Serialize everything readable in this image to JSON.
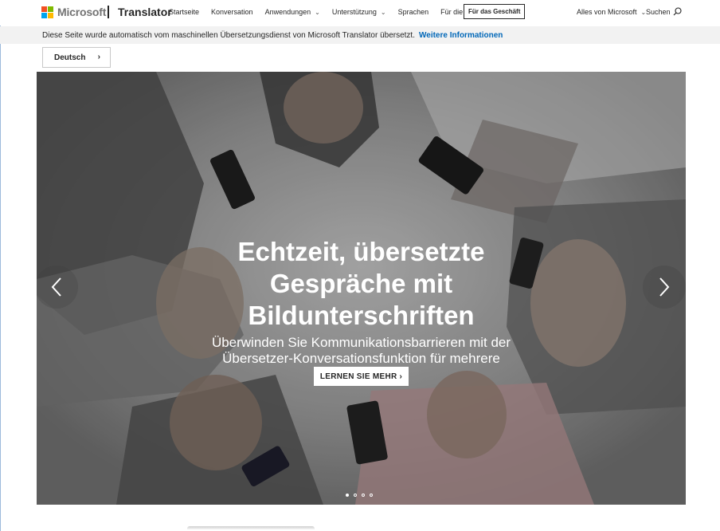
{
  "header": {
    "brand": "Microsoft",
    "product": "Translator",
    "nav": [
      {
        "label": "Startseite",
        "dropdown": false
      },
      {
        "label": "Konversation",
        "dropdown": false
      },
      {
        "label": "Anwendungen",
        "dropdown": true
      },
      {
        "label": "Unterstützung",
        "dropdown": true
      },
      {
        "label": "Sprachen",
        "dropdown": false
      },
      {
        "label": "Für die Bildung",
        "dropdown": false
      }
    ],
    "business_button": "Für das Geschäft",
    "all_microsoft": "Alles von Microsoft",
    "search_label": "Suchen",
    "logo_colors": [
      "#f25022",
      "#7fba00",
      "#00a4ef",
      "#ffb900"
    ]
  },
  "translation_bar": {
    "message": "Diese Seite wurde automatisch vom maschinellen Übersetzungsdienst von Microsoft Translator übersetzt.",
    "link": "Weitere Informationen"
  },
  "language_selector": {
    "value": "Deutsch",
    "icon": "chevron-right-icon"
  },
  "hero": {
    "title": "Echtzeit, übersetzte Gespräche mit Bildunterschriften",
    "subtitle": "Überwinden Sie Kommunikationsbarrieren mit der Übersetzer-Konversationsfunktion für mehrere Geräte",
    "cta": "LERNEN SIE MEHR",
    "slide_count": 4,
    "active_slide": 1
  },
  "colors": {
    "link": "#0067b8",
    "bar_bg": "#f2f2f2"
  }
}
